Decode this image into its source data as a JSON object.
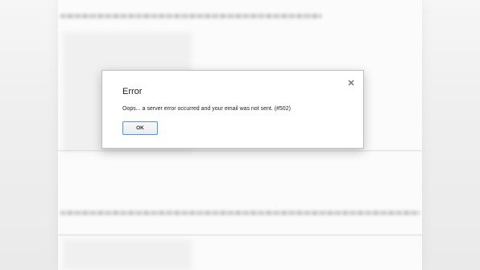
{
  "dialog": {
    "title": "Error",
    "message": "Oops... a server error occurred and your email was not sent. (#502)",
    "ok_label": "OK",
    "close_icon": "close-icon"
  },
  "background": {
    "description_state": "blurred"
  },
  "colors": {
    "button_border": "#4d90fe",
    "dialog_bg": "#ffffff",
    "text": "#222222"
  }
}
